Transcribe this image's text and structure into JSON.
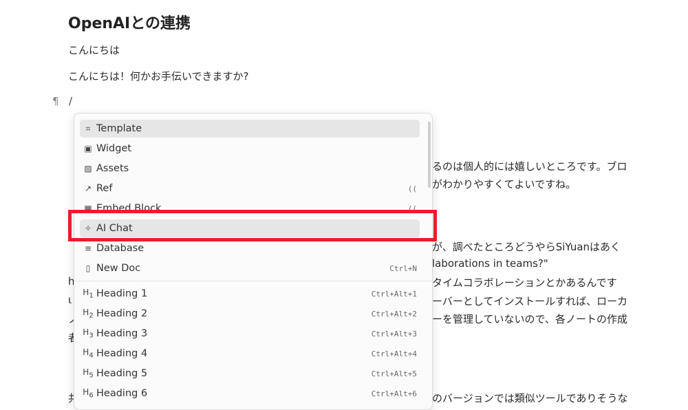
{
  "doc": {
    "title": "OpenAIとの連携",
    "p1": "こんにちは",
    "p2": "こんにちは！何かお手伝いできますか?",
    "pilcrow": "¶",
    "slash": "/",
    "bg_lines": [
      {
        "text": "るのは個人的には嬉しいところです。ブロ"
      },
      {
        "text": "がわかりやすくてよいですね。"
      },
      {
        "text": "が、調べたところどうやらSiYuanはあく"
      },
      {
        "text": "laborations in teams?\""
      },
      {
        "text": "タイムコラボレーションとかあるんです"
      },
      {
        "text": "ーバーとしてインストールすれば、ローカ"
      },
      {
        "text": "ーを管理していないので、各ノートの作成"
      },
      {
        "text": "のバージョンでは類似ツールでありそうな"
      }
    ],
    "left_fragments": [
      "h",
      "ι",
      "ノ",
      "者",
      "共"
    ]
  },
  "menu": {
    "items": [
      {
        "icon": "template-icon",
        "glyph": "⌗",
        "label": "Template",
        "kbd": ""
      },
      {
        "icon": "widget-icon",
        "glyph": "▣",
        "label": "Widget",
        "kbd": ""
      },
      {
        "icon": "assets-icon",
        "glyph": "▨",
        "label": "Assets",
        "kbd": ""
      },
      {
        "icon": "ref-icon",
        "glyph": "↗",
        "label": "Ref",
        "kbd": "(("
      },
      {
        "icon": "embed-block-icon",
        "glyph": "▦",
        "label": "Embed Block",
        "kbd": "(("
      },
      {
        "icon": "ai-chat-icon",
        "glyph": "✧",
        "label": "AI Chat",
        "kbd": ""
      },
      {
        "icon": "database-icon",
        "glyph": "≡",
        "label": "Database",
        "kbd": ""
      },
      {
        "icon": "new-doc-icon",
        "glyph": "▯",
        "label": "New Doc",
        "kbd": "Ctrl+N"
      }
    ],
    "headings": [
      {
        "num": "1",
        "label": "Heading 1",
        "kbd": "Ctrl+Alt+1"
      },
      {
        "num": "2",
        "label": "Heading 2",
        "kbd": "Ctrl+Alt+2"
      },
      {
        "num": "3",
        "label": "Heading 3",
        "kbd": "Ctrl+Alt+3"
      },
      {
        "num": "4",
        "label": "Heading 4",
        "kbd": "Ctrl+Alt+4"
      },
      {
        "num": "5",
        "label": "Heading 5",
        "kbd": "Ctrl+Alt+5"
      },
      {
        "num": "6",
        "label": "Heading 6",
        "kbd": "Ctrl+Alt+6"
      }
    ],
    "heading_prefix": "H"
  },
  "colors": {
    "highlight": "#f01b2a",
    "selected": "#e6e6e6"
  }
}
